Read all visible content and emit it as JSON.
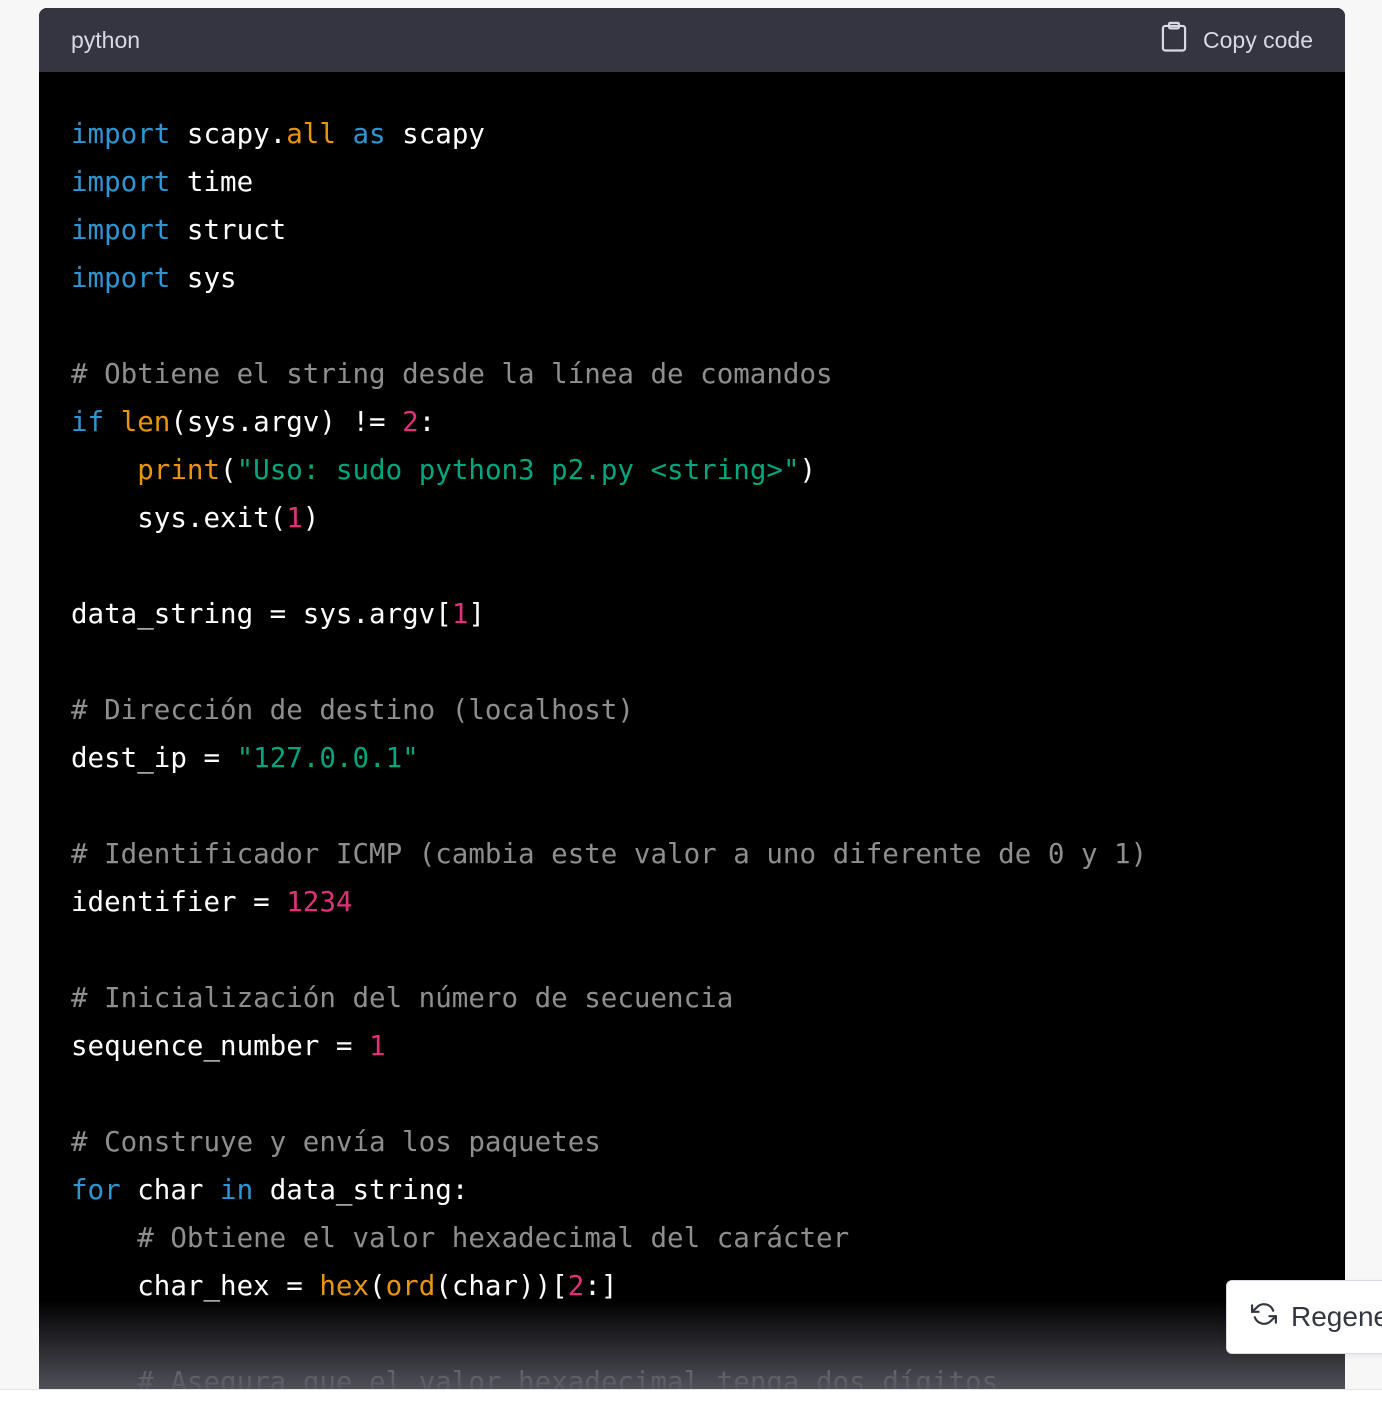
{
  "code_block": {
    "language": "python",
    "copy_label": "Copy code",
    "lines": [
      [
        {
          "t": "kw",
          "v": "import"
        },
        {
          "t": "",
          "v": " scapy."
        },
        {
          "t": "fn",
          "v": "all"
        },
        {
          "t": "",
          "v": " "
        },
        {
          "t": "kw",
          "v": "as"
        },
        {
          "t": "",
          "v": " scapy"
        }
      ],
      [
        {
          "t": "kw",
          "v": "import"
        },
        {
          "t": "",
          "v": " time"
        }
      ],
      [
        {
          "t": "kw",
          "v": "import"
        },
        {
          "t": "",
          "v": " struct"
        }
      ],
      [
        {
          "t": "kw",
          "v": "import"
        },
        {
          "t": "",
          "v": " sys"
        }
      ],
      [],
      [
        {
          "t": "cm",
          "v": "# Obtiene el string desde la línea de comandos"
        }
      ],
      [
        {
          "t": "kw",
          "v": "if"
        },
        {
          "t": "",
          "v": " "
        },
        {
          "t": "fn",
          "v": "len"
        },
        {
          "t": "",
          "v": "(sys.argv) != "
        },
        {
          "t": "num",
          "v": "2"
        },
        {
          "t": "",
          "v": ":"
        }
      ],
      [
        {
          "t": "",
          "v": "    "
        },
        {
          "t": "fn",
          "v": "print"
        },
        {
          "t": "",
          "v": "("
        },
        {
          "t": "str",
          "v": "\"Uso: sudo python3 p2.py <string>\""
        },
        {
          "t": "",
          "v": ")"
        }
      ],
      [
        {
          "t": "",
          "v": "    sys.exit("
        },
        {
          "t": "num",
          "v": "1"
        },
        {
          "t": "",
          "v": ")"
        }
      ],
      [],
      [
        {
          "t": "",
          "v": "data_string = sys.argv["
        },
        {
          "t": "num",
          "v": "1"
        },
        {
          "t": "",
          "v": "]"
        }
      ],
      [],
      [
        {
          "t": "cm",
          "v": "# Dirección de destino (localhost)"
        }
      ],
      [
        {
          "t": "",
          "v": "dest_ip = "
        },
        {
          "t": "str",
          "v": "\"127.0.0.1\""
        }
      ],
      [],
      [
        {
          "t": "cm",
          "v": "# Identificador ICMP (cambia este valor a uno diferente de 0 y 1)"
        }
      ],
      [
        {
          "t": "",
          "v": "identifier = "
        },
        {
          "t": "num",
          "v": "1234"
        }
      ],
      [],
      [
        {
          "t": "cm",
          "v": "# Inicialización del número de secuencia"
        }
      ],
      [
        {
          "t": "",
          "v": "sequence_number = "
        },
        {
          "t": "num",
          "v": "1"
        }
      ],
      [],
      [
        {
          "t": "cm",
          "v": "# Construye y envía los paquetes"
        }
      ],
      [
        {
          "t": "kw",
          "v": "for"
        },
        {
          "t": "",
          "v": " char "
        },
        {
          "t": "kw",
          "v": "in"
        },
        {
          "t": "",
          "v": " data_string:"
        }
      ],
      [
        {
          "t": "",
          "v": "    "
        },
        {
          "t": "cm",
          "v": "# Obtiene el valor hexadecimal del carácter"
        }
      ],
      [
        {
          "t": "",
          "v": "    char_hex = "
        },
        {
          "t": "fn",
          "v": "hex"
        },
        {
          "t": "",
          "v": "("
        },
        {
          "t": "fn",
          "v": "ord"
        },
        {
          "t": "",
          "v": "(char))["
        },
        {
          "t": "num",
          "v": "2"
        },
        {
          "t": "",
          "v": ":]"
        }
      ],
      [],
      [
        {
          "t": "",
          "v": "    "
        },
        {
          "t": "cm",
          "v": "# Asegura que el valor hexadecimal tenga dos dígitos"
        }
      ]
    ]
  },
  "regenerate_button": {
    "label": "Regene"
  },
  "icons": {
    "copy": "clipboard-icon",
    "regenerate": "refresh-icon"
  },
  "colors": {
    "keyword": "#2e95d3",
    "function": "#e9950c",
    "string": "#00a67d",
    "number": "#df3079",
    "comment": "#8e8e8e",
    "header_bg": "#343541",
    "code_bg": "#000000"
  }
}
